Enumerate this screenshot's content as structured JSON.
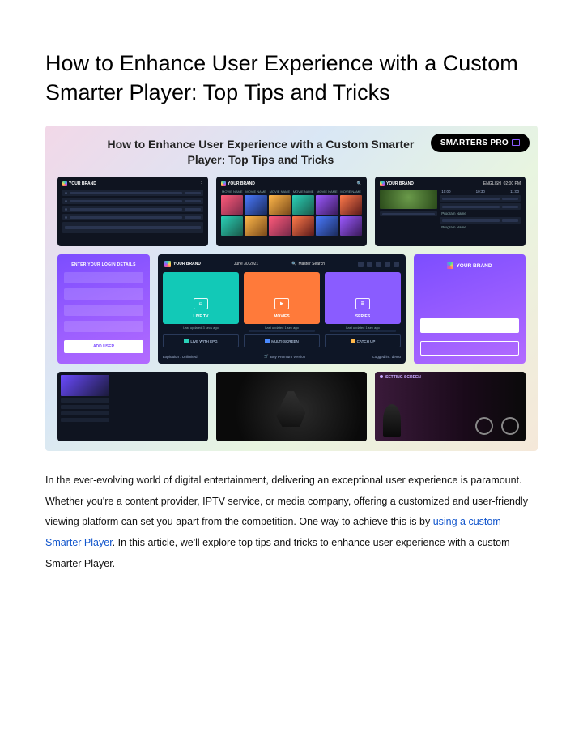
{
  "title": "How to Enhance User Experience with a Custom Smarter Player: Top Tips and Tricks",
  "hero": {
    "heading": "How to Enhance User Experience with a Custom Smarter Player: Top Tips and Tricks",
    "badge": "SMARTERS PRO",
    "brand": "YOUR BRAND",
    "login": {
      "title": "ENTER YOUR LOGIN DETAILS",
      "button": "ADD USER"
    },
    "dashboard": {
      "brand": "YOUR BRAND",
      "date": "June 30,2021",
      "search": "Master Search",
      "tiles": {
        "live": "LIVE TV",
        "live_sub": "Last updated 3 secs ago",
        "movies": "MOVIES",
        "movies_sub": "Last updated 1 sec ago",
        "series": "SERIES",
        "series_sub": "Last updated 1 sec ago"
      },
      "chips": {
        "epg": "LIVE WITH EPG",
        "multi": "MULTI-SCREEN",
        "catchup": "CATCH UP"
      },
      "footer": {
        "exp": "Expiration : Unlimited",
        "buy": "Buy Premium Version",
        "logged": "Logged in : demo"
      }
    },
    "brandcard": {
      "brand": "YOUR BRAND"
    },
    "epg_right": {
      "brand": "YOUR BRAND",
      "lang": "ENGLISH",
      "time_pm": "02:00 PM",
      "t1": "10:00",
      "t2": "10:30",
      "t3": "11:00",
      "pn": "Program Name"
    },
    "mid_grid": {
      "brand": "YOUR BRAND",
      "m1": "MOVIE NAME",
      "m2": "MOVIE NAME",
      "m3": "MOVIE NAME",
      "m4": "MOVIE NAME",
      "m5": "MOVIE NAME",
      "m6": "MOVIE NAME"
    },
    "bot_right": {
      "title": "SETTING SCREEN"
    }
  },
  "paragraph": {
    "p1": "In the ever-evolving world of digital entertainment, delivering an exceptional user experience is paramount. Whether you're a content provider, IPTV service, or media company, offering a customized and user-friendly viewing platform can set you apart from the competition. One way to achieve this is by ",
    "link": "using a custom Smarter Player",
    "p2": ". In this article, we'll explore top tips and tricks to enhance user experience with a custom Smarter Player."
  }
}
